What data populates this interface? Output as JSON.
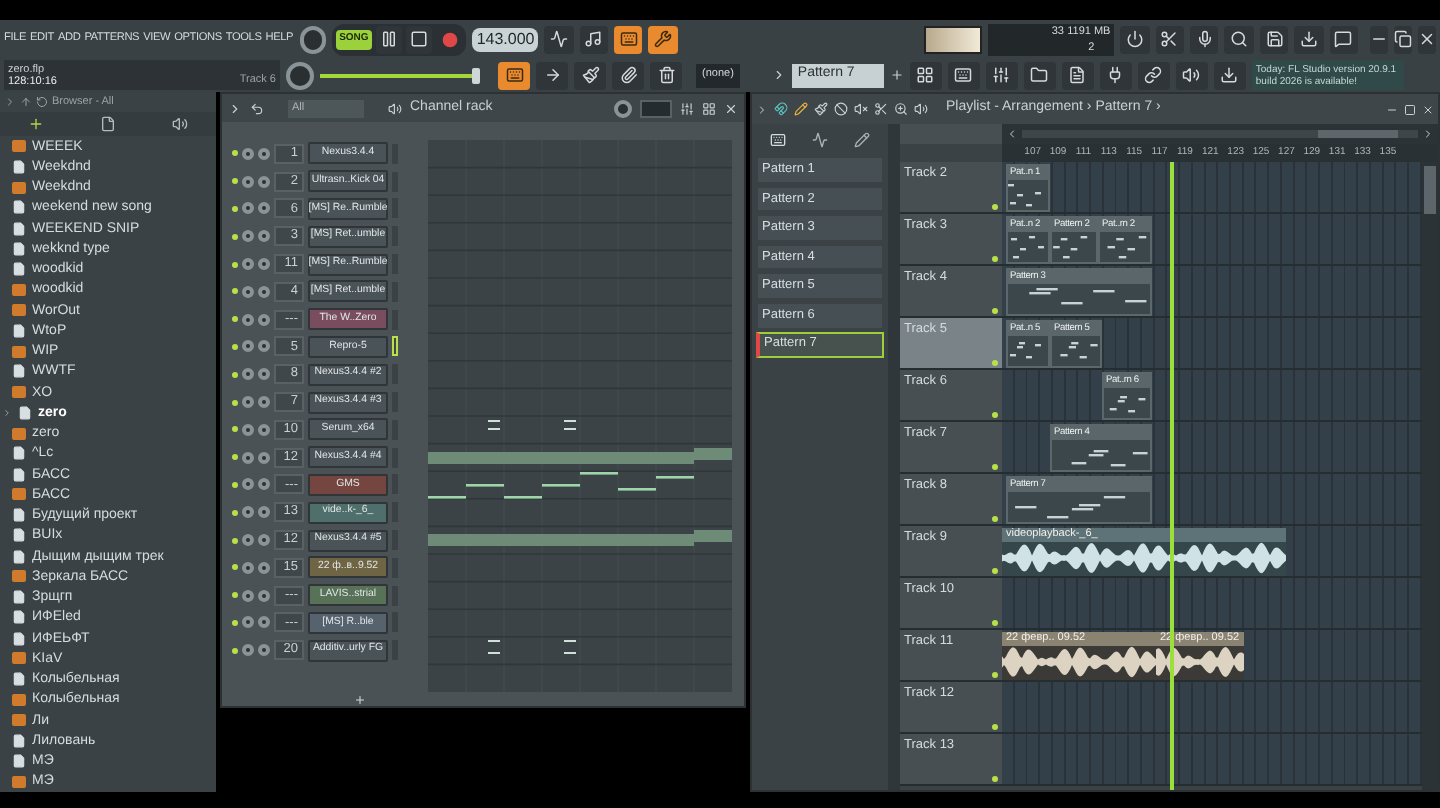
{
  "menu": [
    "FILE",
    "EDIT",
    "ADD",
    "PATTERNS",
    "VIEW",
    "OPTIONS",
    "TOOLS",
    "HELP"
  ],
  "transport": {
    "mode": "SONG",
    "song_mode": true,
    "tempo": "143.000"
  },
  "project": {
    "file": "zero.flp",
    "position": "128:10:16",
    "track": "Track 6"
  },
  "master_pitch": {
    "level": 0.97
  },
  "snap": "(none)",
  "current_pattern": "Pattern 7",
  "monitor": {
    "cpu": "33",
    "memory": "1191 MB",
    "polyphony": "2"
  },
  "hint": "Today: FL Studio version 20.9.1 build 2026 is available!",
  "browser": {
    "title": "Browser - All",
    "items": [
      {
        "name": "WEEEK",
        "kind": "project"
      },
      {
        "name": "Weekdnd",
        "kind": "file"
      },
      {
        "name": "Weekdnd",
        "kind": "project"
      },
      {
        "name": "weekend new song",
        "kind": "file"
      },
      {
        "name": "WEEKEND SNIP",
        "kind": "file"
      },
      {
        "name": "wekknd type",
        "kind": "file"
      },
      {
        "name": "woodkid",
        "kind": "file"
      },
      {
        "name": "woodkid",
        "kind": "project"
      },
      {
        "name": "WorOut",
        "kind": "project"
      },
      {
        "name": "WtoP",
        "kind": "file"
      },
      {
        "name": "WIP",
        "kind": "project"
      },
      {
        "name": "WWTF",
        "kind": "file"
      },
      {
        "name": "XO",
        "kind": "project"
      },
      {
        "name": "zero",
        "kind": "folder"
      },
      {
        "name": "zero",
        "kind": "project"
      },
      {
        "name": "^Lc",
        "kind": "file"
      },
      {
        "name": "БАСС",
        "kind": "file"
      },
      {
        "name": "БАСС",
        "kind": "project"
      },
      {
        "name": "Будущий проект",
        "kind": "file"
      },
      {
        "name": "BUIx",
        "kind": "file"
      },
      {
        "name": "Дыщим дыщим трек",
        "kind": "file"
      },
      {
        "name": "Зеркала БАСС",
        "kind": "project"
      },
      {
        "name": "Зрщгп",
        "kind": "file"
      },
      {
        "name": "ИФЕled",
        "kind": "file"
      },
      {
        "name": "ИФЕЬФТ",
        "kind": "file"
      },
      {
        "name": "KIaV",
        "kind": "project"
      },
      {
        "name": "Колыбельная",
        "kind": "file"
      },
      {
        "name": "Колыбельная",
        "kind": "project"
      },
      {
        "name": "Ли",
        "kind": "project"
      },
      {
        "name": "Лиловань",
        "kind": "file"
      },
      {
        "name": "МЭ",
        "kind": "file"
      },
      {
        "name": "МЭ",
        "kind": "project"
      }
    ]
  },
  "channel_rack": {
    "filter": "All",
    "title": "Channel rack",
    "channels": [
      {
        "insert": "1",
        "name": "Nexus3.4.4",
        "color": "#4a5357",
        "selected": false
      },
      {
        "insert": "2",
        "name": "Ultrasn..Kick 04",
        "color": "#4a5357",
        "selected": false
      },
      {
        "insert": "6",
        "name": "[MS] Re..Rumble",
        "color": "#4a5357",
        "selected": false
      },
      {
        "insert": "3",
        "name": "[MS] Ret..umble",
        "color": "#4a5357",
        "selected": false
      },
      {
        "insert": "11",
        "name": "[MS] Re..Rumble",
        "color": "#4a5357",
        "selected": false
      },
      {
        "insert": "4",
        "name": "[MS] Ret..umble",
        "color": "#4a5357",
        "selected": false
      },
      {
        "insert": "---",
        "name": "The W..Zero",
        "color": "#7a4d5e",
        "selected": false
      },
      {
        "insert": "5",
        "name": "Repro-5",
        "color": "#4a5357",
        "selected": true
      },
      {
        "insert": "8",
        "name": "Nexus3.4.4 #2",
        "color": "#4a5357",
        "selected": false
      },
      {
        "insert": "7",
        "name": "Nexus3.4.4 #3",
        "color": "#4a5357",
        "selected": false
      },
      {
        "insert": "10",
        "name": "Serum_x64",
        "color": "#4a5357",
        "selected": false
      },
      {
        "insert": "12",
        "name": "Nexus3.4.4 #4",
        "color": "#4a5357",
        "selected": false
      },
      {
        "insert": "---",
        "name": "GMS",
        "color": "#74463f",
        "selected": false
      },
      {
        "insert": "13",
        "name": "vide..k-_6_",
        "color": "#4f6f6c",
        "selected": false
      },
      {
        "insert": "12",
        "name": "Nexus3.4.4 #5",
        "color": "#4a5357",
        "selected": false
      },
      {
        "insert": "15",
        "name": "22 ф..в..9.52",
        "color": "#6f6444",
        "selected": false
      },
      {
        "insert": "---",
        "name": "LAVIS..strial",
        "color": "#587257",
        "selected": false
      },
      {
        "insert": "---",
        "name": "[MS] R..ble",
        "color": "#56626e",
        "selected": false
      },
      {
        "insert": "20",
        "name": "Additiv..urly FG",
        "color": "#4a5357",
        "selected": false
      }
    ]
  },
  "playlist": {
    "title": "Playlist - Arrangement › Pattern 7 ›",
    "patterns": [
      {
        "name": "Pattern 1",
        "selected": false
      },
      {
        "name": "Pattern 2",
        "selected": false
      },
      {
        "name": "Pattern 3",
        "selected": false
      },
      {
        "name": "Pattern 4",
        "selected": false
      },
      {
        "name": "Pattern 5",
        "selected": false
      },
      {
        "name": "Pattern 6",
        "selected": false
      },
      {
        "name": "Pattern 7",
        "selected": true
      }
    ],
    "ruler": [
      "107",
      "109",
      "111",
      "113",
      "115",
      "117",
      "119",
      "121",
      "123",
      "125",
      "127",
      "129",
      "131",
      "133",
      "135"
    ],
    "tracks": [
      {
        "name": "Track 2",
        "selected": false,
        "clips": [
          {
            "kind": "pattern",
            "label": "Pat..n 1"
          }
        ]
      },
      {
        "name": "Track 3",
        "selected": false,
        "clips": [
          {
            "kind": "pattern",
            "label": "Pat..n 2"
          },
          {
            "kind": "pattern",
            "label": "Pattern 2"
          },
          {
            "kind": "pattern",
            "label": "Pat..rn 2"
          }
        ]
      },
      {
        "name": "Track 4",
        "selected": false,
        "clips": [
          {
            "kind": "pattern",
            "label": "Pattern 3"
          }
        ]
      },
      {
        "name": "Track 5",
        "selected": true,
        "clips": [
          {
            "kind": "pattern",
            "label": "Pat..n 5"
          },
          {
            "kind": "pattern",
            "label": "Pattern 5"
          }
        ]
      },
      {
        "name": "Track 6",
        "selected": false,
        "clips": [
          {
            "kind": "pattern",
            "label": "Pat..rn 6"
          }
        ]
      },
      {
        "name": "Track 7",
        "selected": false,
        "clips": [
          {
            "kind": "pattern",
            "label": "Pattern 4"
          }
        ]
      },
      {
        "name": "Track 8",
        "selected": false,
        "clips": [
          {
            "kind": "pattern",
            "label": "Pattern 7"
          }
        ]
      },
      {
        "name": "Track 9",
        "selected": false,
        "clips": [
          {
            "kind": "audio",
            "label": "videoplayback-_6_"
          }
        ]
      },
      {
        "name": "Track 10",
        "selected": false
      },
      {
        "name": "Track 11",
        "selected": false,
        "clips": [
          {
            "kind": "voice",
            "label": "22 февр.. 09.52"
          },
          {
            "kind": "voice",
            "label": "22 февр.. 09.52"
          }
        ]
      },
      {
        "name": "Track 12",
        "selected": false
      },
      {
        "name": "Track 13",
        "selected": false
      }
    ]
  }
}
